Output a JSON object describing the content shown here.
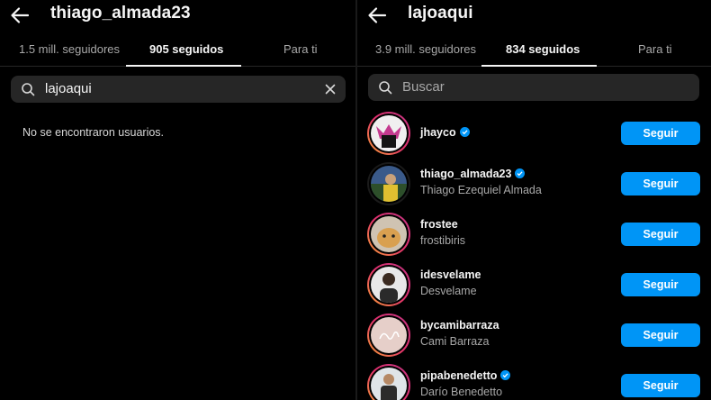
{
  "left_panel": {
    "title": "thiago_almada23",
    "tabs": [
      {
        "label": "1.5 mill. seguidores"
      },
      {
        "label": "905 seguidos"
      },
      {
        "label": "Para ti"
      }
    ],
    "active_tab": 1,
    "search": {
      "value": "lajoaqui",
      "icon": "search-icon",
      "clear_icon": "close-icon"
    },
    "empty_message": "No se encontraron usuarios."
  },
  "right_panel": {
    "title": "lajoaqui",
    "tabs": [
      {
        "label": "3.9 mill. seguidores"
      },
      {
        "label": "834 seguidos"
      },
      {
        "label": "Para ti"
      }
    ],
    "active_tab": 1,
    "search": {
      "placeholder": "Buscar",
      "icon": "search-icon"
    },
    "users": [
      {
        "username": "jhayco",
        "full_name": "",
        "verified": true,
        "button": "Seguir"
      },
      {
        "username": "thiago_almada23",
        "full_name": "Thiago Ezequiel Almada",
        "verified": true,
        "button": "Seguir"
      },
      {
        "username": "frostee",
        "full_name": "frostibiris",
        "verified": false,
        "button": "Seguir"
      },
      {
        "username": "idesvelame",
        "full_name": "Desvelame",
        "verified": false,
        "button": "Seguir"
      },
      {
        "username": "bycamibarraza",
        "full_name": "Cami Barraza",
        "verified": false,
        "button": "Seguir"
      },
      {
        "username": "pipabenedetto",
        "full_name": "Darío Benedetto",
        "verified": true,
        "button": "Seguir"
      }
    ]
  },
  "colors": {
    "background": "#000000",
    "follow_button": "#0095f6",
    "verified_badge": "#0095f6",
    "secondary_text": "#a8a8a8",
    "search_bg": "#262626"
  }
}
